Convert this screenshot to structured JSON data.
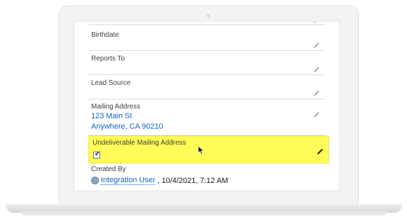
{
  "fields": {
    "birthdate": {
      "label": "Birthdate"
    },
    "reports_to": {
      "label": "Reports To"
    },
    "lead_source": {
      "label": "Lead Source"
    },
    "mailing_address": {
      "label": "Mailing Address",
      "line1": "123 Main St",
      "line2": "Anywhere, CA 90210"
    },
    "undeliverable": {
      "label": "Undeliverable Mailing Address",
      "checked": true,
      "check_glyph": "✔"
    },
    "created_by": {
      "label": "Created By",
      "user": "Integration User",
      "timestamp": ", 10/4/2021, 7:12 AM"
    }
  },
  "icons": {
    "pencil": "pencil-icon",
    "avatar": "user-avatar-icon",
    "cursor": "mouse-pointer-icon"
  },
  "colors": {
    "highlight": "#fffb57",
    "link": "#0b66c9",
    "label": "#3e3e3c"
  }
}
